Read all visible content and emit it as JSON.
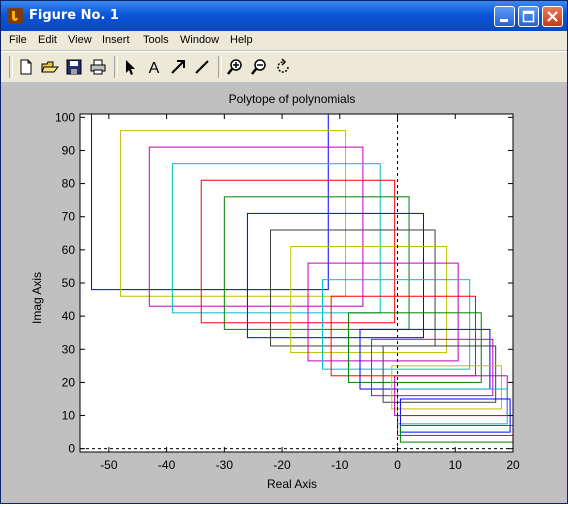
{
  "window": {
    "title": "Figure No. 1",
    "buttons": [
      "minimize",
      "maximize",
      "close"
    ]
  },
  "menu": {
    "items": [
      "File",
      "Edit",
      "View",
      "Insert",
      "Tools",
      "Window",
      "Help"
    ]
  },
  "toolbar": {
    "icons": [
      "new-figure-icon",
      "open-file-icon",
      "save-icon",
      "print-icon",
      "edit-plot-arrow-icon",
      "insert-text-icon",
      "insert-arrow-icon",
      "insert-line-icon",
      "zoom-in-icon",
      "zoom-out-icon",
      "rotate-3d-icon"
    ],
    "text_tool_label": "A"
  },
  "colors": {
    "plot_colors": [
      "#0000ff",
      "#008000",
      "#ff0000",
      "#00bfbf",
      "#bf00bf",
      "#bfbf00",
      "#404040"
    ]
  },
  "chart_data": {
    "type": "line",
    "title": "Polytope of polynomials",
    "xlabel": "Real Axis",
    "ylabel": "Imag Axis",
    "xlim": [
      -55,
      20
    ],
    "ylim": [
      -1,
      101
    ],
    "xticks": [
      "-50",
      "-40",
      "-30",
      "-20",
      "-10",
      "0",
      "10",
      "20"
    ],
    "yticks": [
      "0",
      "10",
      "20",
      "30",
      "40",
      "50",
      "60",
      "70",
      "80",
      "90",
      "100"
    ],
    "xtick_values": [
      -50,
      -40,
      -30,
      -20,
      -10,
      0,
      10,
      20
    ],
    "ytick_values": [
      0,
      10,
      20,
      30,
      40,
      50,
      60,
      70,
      80,
      90,
      100
    ],
    "rectangles": [
      {
        "x1": -53,
        "x2": -12,
        "y1": 48,
        "y2": 101,
        "color": "#0000ff"
      },
      {
        "x1": -48,
        "x2": -9,
        "y1": 46,
        "y2": 96,
        "color": "#bfbf00"
      },
      {
        "x1": -43,
        "x2": -6,
        "y1": 43,
        "y2": 91,
        "color": "#bf00bf"
      },
      {
        "x1": -39,
        "x2": -3,
        "y1": 41,
        "y2": 86,
        "color": "#00bfbf"
      },
      {
        "x1": -34,
        "x2": -0.5,
        "y1": 38,
        "y2": 81,
        "color": "#ff0000"
      },
      {
        "x1": -30,
        "x2": 2,
        "y1": 36,
        "y2": 76,
        "color": "#008000"
      },
      {
        "x1": -26,
        "x2": 4.5,
        "y1": 33.5,
        "y2": 71,
        "color": "#0000ff"
      },
      {
        "x1": -22,
        "x2": 6.5,
        "y1": 31,
        "y2": 66,
        "color": "#404040"
      },
      {
        "x1": -18.5,
        "x2": 8.5,
        "y1": 29,
        "y2": 61,
        "color": "#bfbf00"
      },
      {
        "x1": -15.5,
        "x2": 10.5,
        "y1": 26.5,
        "y2": 56,
        "color": "#bf00bf"
      },
      {
        "x1": -13,
        "x2": 12.5,
        "y1": 24,
        "y2": 51,
        "color": "#00bfbf"
      },
      {
        "x1": -11.5,
        "x2": 13.5,
        "y1": 22,
        "y2": 46,
        "color": "#ff0000"
      },
      {
        "x1": -8.5,
        "x2": 14.5,
        "y1": 20,
        "y2": 41,
        "color": "#008000"
      },
      {
        "x1": -6.5,
        "x2": 16,
        "y1": 18,
        "y2": 36,
        "color": "#0000ff"
      },
      {
        "x1": -4.5,
        "x2": 16.5,
        "y1": 16,
        "y2": 33,
        "color": "#bf00bf"
      },
      {
        "x1": -2.5,
        "x2": 17,
        "y1": 14,
        "y2": 31,
        "color": "#404040"
      },
      {
        "x1": -1,
        "x2": 18,
        "y1": 12,
        "y2": 25,
        "color": "#bfbf00"
      },
      {
        "x1": -0.5,
        "x2": 19,
        "y1": 10,
        "y2": 22,
        "color": "#bf00bf"
      },
      {
        "x1": 0,
        "x2": 19,
        "y1": 7.5,
        "y2": 18,
        "color": "#00bfbf"
      },
      {
        "x1": 0.5,
        "x2": 19.5,
        "y1": 5,
        "y2": 15,
        "color": "#0000ff"
      },
      {
        "x1": 0,
        "x2": 20,
        "y1": 4,
        "y2": 10,
        "color": "#ff0000"
      },
      {
        "x1": 0.5,
        "x2": 20,
        "y1": 2,
        "y2": 7,
        "color": "#008000"
      }
    ],
    "dashed_lines": [
      {
        "x": [
          0,
          0
        ],
        "y": [
          -1,
          101
        ]
      },
      {
        "x": [
          -55,
          20
        ],
        "y": [
          0,
          0
        ]
      }
    ],
    "grid": false,
    "legend": "none"
  }
}
